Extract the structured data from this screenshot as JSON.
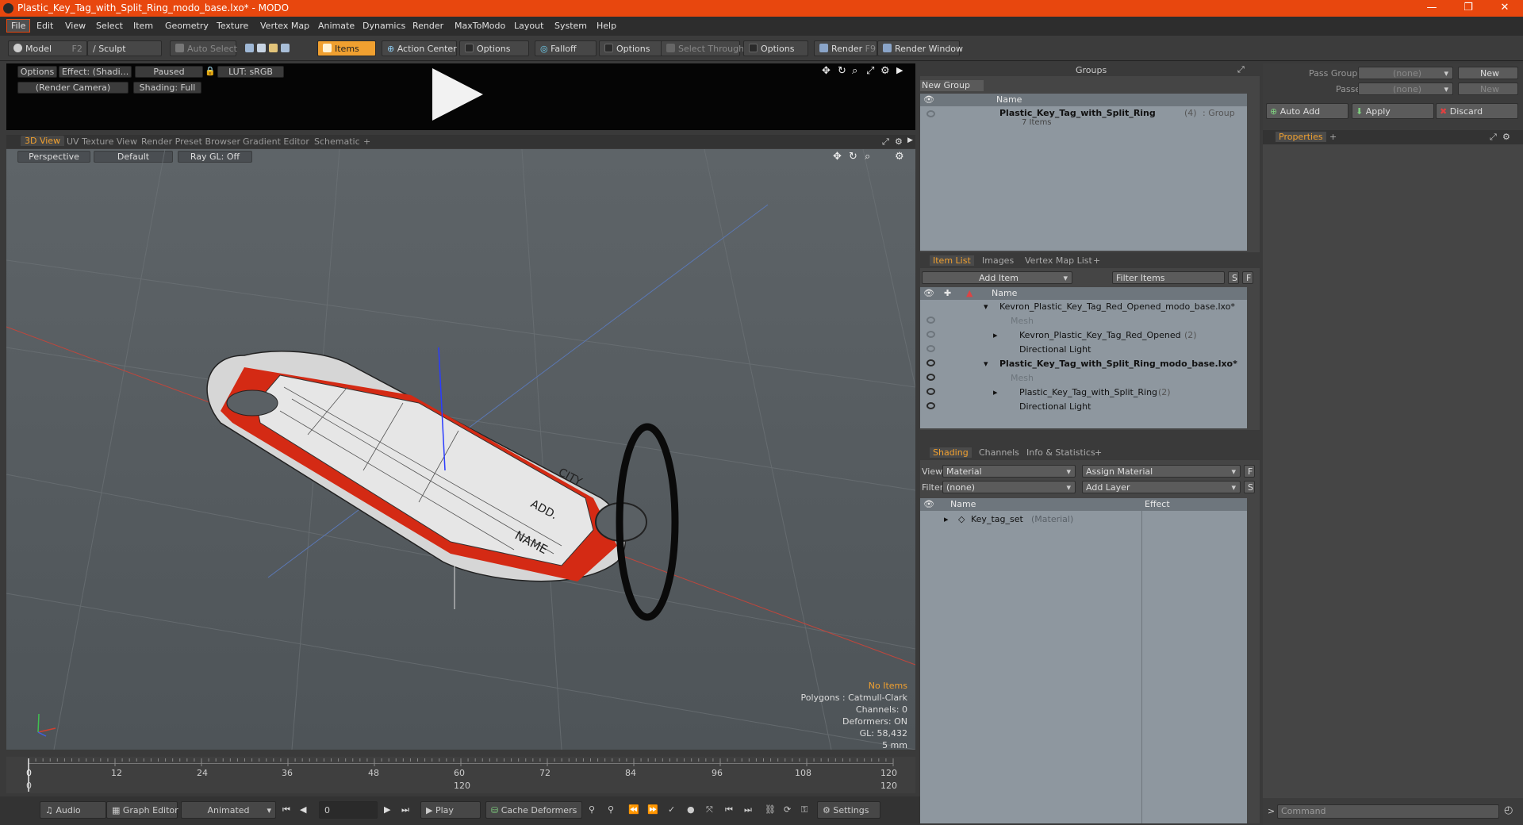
{
  "window": {
    "title": "Plastic_Key_Tag_with_Split_Ring_modo_base.lxo* - MODO"
  },
  "menu": [
    "File",
    "Edit",
    "View",
    "Select",
    "Item",
    "Geometry",
    "Texture",
    "Vertex Map",
    "Animate",
    "Dynamics",
    "Render",
    "MaxToModo",
    "Layout",
    "System",
    "Help"
  ],
  "toolbar": {
    "model": "Model",
    "model_key": "F2",
    "sculpt": "Sculpt",
    "auto_select": "Auto Select",
    "items": "Items",
    "action_center": "Action Center",
    "options1": "Options",
    "falloff": "Falloff",
    "options2": "Options",
    "select_through": "Select Through",
    "options3": "Options",
    "render": "Render",
    "render_key": "F9",
    "render_window": "Render Window"
  },
  "preview": {
    "options": "Options",
    "effect": "Effect: (Shadi...",
    "paused": "Paused",
    "lut": "LUT: sRGB",
    "camera": "(Render Camera)",
    "shading": "Shading: Full"
  },
  "viewport_tabs": [
    "3D View",
    "UV Texture View",
    "Render Preset Browser",
    "Gradient Editor",
    "Schematic",
    "+"
  ],
  "viewport": {
    "perspective": "Perspective",
    "default": "Default",
    "raygl": "Ray GL: Off",
    "label_name": "NAME",
    "label_add": "ADD.",
    "label_city": "CITY",
    "stats": {
      "items": "No Items",
      "polygons": "Polygons : Catmull-Clark",
      "channels": "Channels: 0",
      "deformers": "Deformers: ON",
      "gl": "GL: 58,432",
      "unit": "5 mm"
    }
  },
  "timeline": {
    "ticks": [
      "0",
      "12",
      "24",
      "36",
      "48",
      "60",
      "72",
      "84",
      "96",
      "108",
      "120"
    ],
    "end_left": "0",
    "mid": "120",
    "end_right": "120"
  },
  "bottombar": {
    "audio": "Audio",
    "graph_editor": "Graph Editor",
    "animated": "Animated",
    "frame": "0",
    "play": "Play",
    "cache": "Cache Deformers",
    "settings": "Settings"
  },
  "groups": {
    "title": "Groups",
    "new_group": "New Group",
    "col_name": "Name",
    "item_name": "Plastic_Key_Tag_with_Split_Ring",
    "item_count": "(4)",
    "item_type": ": Group",
    "item_sub": "7 Items"
  },
  "itemlist": {
    "tabs": [
      "Item List",
      "Images",
      "Vertex Map List",
      "+"
    ],
    "add_item": "Add Item",
    "filter": "Filter Items",
    "s": "S",
    "f": "F",
    "col_name": "Name",
    "rows": [
      {
        "label": "Kevron_Plastic_Key_Tag_Red_Opened_modo_base.lxo*",
        "extra": ""
      },
      {
        "label": "Mesh",
        "extra": ""
      },
      {
        "label": "Kevron_Plastic_Key_Tag_Red_Opened",
        "extra": "(2)"
      },
      {
        "label": "Directional Light",
        "extra": ""
      },
      {
        "label": "Plastic_Key_Tag_with_Split_Ring_modo_base.lxo*",
        "extra": ""
      },
      {
        "label": "Mesh",
        "extra": ""
      },
      {
        "label": "Plastic_Key_Tag_with_Split_Ring",
        "extra": "(2)"
      },
      {
        "label": "Directional Light",
        "extra": ""
      }
    ]
  },
  "shading": {
    "tabs": [
      "Shading",
      "Channels",
      "Info & Statistics",
      "+"
    ],
    "view_label": "View",
    "view_value": "Material",
    "assign": "Assign Material",
    "f": "F",
    "filter_label": "Filter",
    "filter_value": "(none)",
    "add_layer": "Add Layer",
    "s": "S",
    "col_name": "Name",
    "col_effect": "Effect",
    "row_name": "Key_tag_set",
    "row_type": "(Material)"
  },
  "right": {
    "pass_groups": "Pass Groups",
    "pass_groups_val": "(none)",
    "new": "New",
    "passes": "Passes",
    "passes_val": "(none)",
    "new2": "New",
    "auto_add": "Auto Add",
    "apply": "Apply",
    "discard": "Discard",
    "properties": "Properties",
    "plus": "+",
    "command": "Command"
  }
}
